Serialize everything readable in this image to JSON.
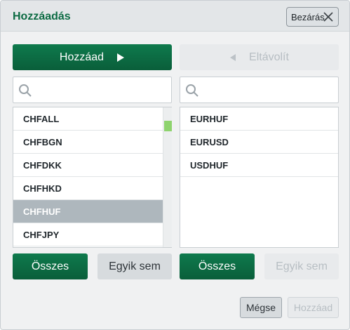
{
  "dialog": {
    "title": "Hozzáadás",
    "close_label": "Bezárás"
  },
  "transfer": {
    "add_label": "Hozzáad",
    "remove_label": "Eltávolít"
  },
  "left": {
    "search_placeholder": "",
    "items": [
      "CHFALL",
      "CHFBGN",
      "CHFDKK",
      "CHFHKD",
      "CHFHUF",
      "CHFJPY"
    ],
    "selected": "CHFHUF",
    "all_label": "Összes",
    "none_label": "Egyik sem"
  },
  "right": {
    "search_placeholder": "",
    "items": [
      "EURHUF",
      "EURUSD",
      "USDHUF"
    ],
    "all_label": "Összes",
    "none_label": "Egyik sem"
  },
  "footer": {
    "cancel_label": "Mégse",
    "confirm_label": "Hozzáad"
  },
  "colors": {
    "accent": "#0c6b43",
    "scroll_thumb": "#8ed36e",
    "selected_row": "#aeb7bd"
  }
}
